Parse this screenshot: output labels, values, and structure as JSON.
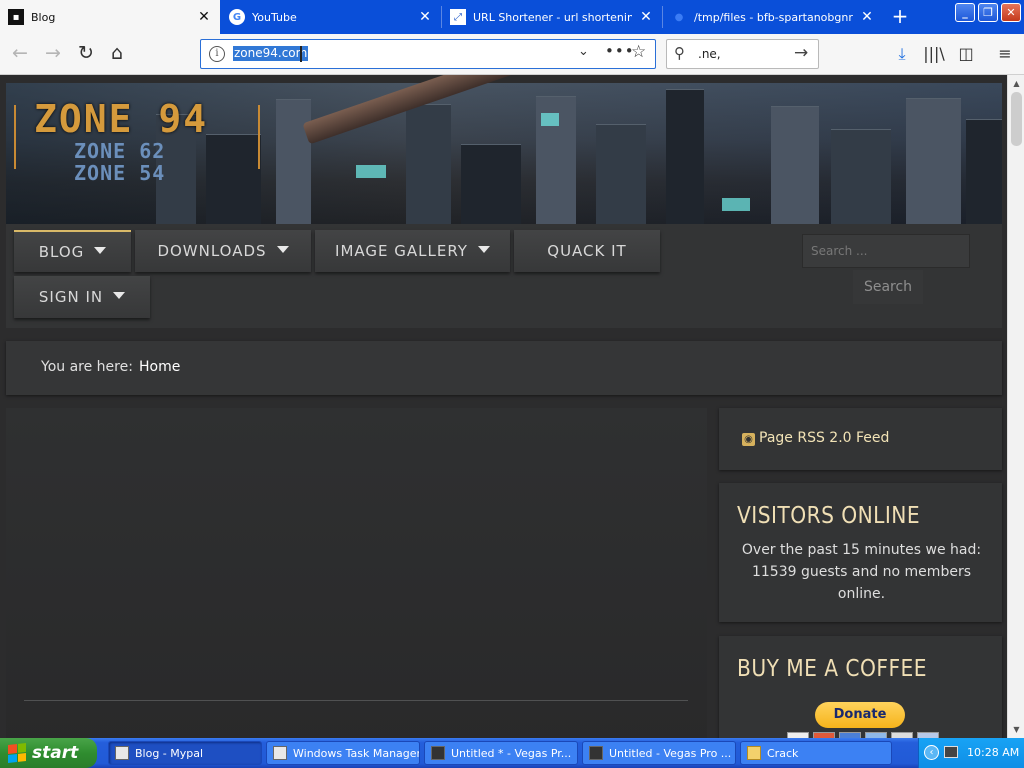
{
  "browser": {
    "tabs": [
      {
        "title": "Blog",
        "active": true
      },
      {
        "title": "YouTube",
        "active": false
      },
      {
        "title": "URL Shortener - url shortening se",
        "active": false
      },
      {
        "title": "/tmp/files - bfb-spartanobgnrem",
        "active": false
      }
    ],
    "url": "zone94.com",
    "search_text": ".ne,",
    "icons": {
      "back": "arrow-left-icon",
      "forward": "arrow-right-icon",
      "reload": "reload-icon",
      "home": "home-icon",
      "downloads": "download-arrow-icon",
      "library": "library-icon",
      "sidebar": "sidebar-icon",
      "menu": "hamburger-menu-icon"
    }
  },
  "site": {
    "logo_main": "ZONE 94",
    "logo_sub1": "ZONE 62",
    "logo_sub2": "ZONE 54",
    "menu": [
      {
        "label": "BLOG",
        "has_dropdown": true,
        "active": true
      },
      {
        "label": "DOWNLOADS",
        "has_dropdown": true,
        "active": false
      },
      {
        "label": "IMAGE GALLERY",
        "has_dropdown": true,
        "active": false
      },
      {
        "label": "QUACK IT",
        "has_dropdown": false,
        "active": false
      },
      {
        "label": "SIGN IN",
        "has_dropdown": true,
        "active": false
      }
    ],
    "search_placeholder": "Search ...",
    "search_button": "Search",
    "breadcrumb_label": "You are here:",
    "breadcrumb_current": "Home",
    "rss_link": "Page RSS 2.0 Feed",
    "visitors_heading": "VISITORS ONLINE",
    "visitors_text": "Over the past 15 minutes we had: 11539 guests and no members online.",
    "coffee_heading": "BUY ME A COFFEE",
    "donate_label": "Donate",
    "colors": {
      "accent_gold": "#f0dfb5",
      "menu_active": "#d9b968",
      "page_bg": "#2c2c2d"
    }
  },
  "taskbar": {
    "start_label": "start",
    "tasks": [
      {
        "label": "Blog - Mypal",
        "pressed": true
      },
      {
        "label": "Windows Task Manager",
        "pressed": false
      },
      {
        "label": "Untitled * - Vegas Pr...",
        "pressed": false
      },
      {
        "label": "Untitled - Vegas Pro ...",
        "pressed": false
      },
      {
        "label": "Crack",
        "pressed": false
      }
    ],
    "clock": "10:28 AM"
  }
}
